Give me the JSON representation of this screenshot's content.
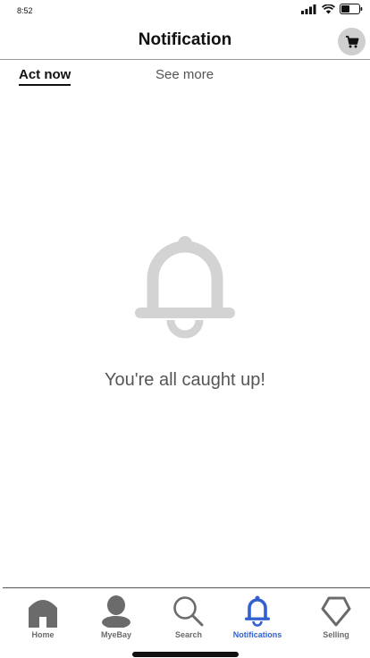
{
  "status": {
    "time": "8:52"
  },
  "header": {
    "title": "Notification",
    "cart_icon": "cart-icon"
  },
  "tabs": [
    {
      "label": "Act now",
      "active": true
    },
    {
      "label": "See more",
      "active": false
    }
  ],
  "empty_state": {
    "icon": "bell-icon",
    "message": "You're all caught up!"
  },
  "nav": {
    "items": [
      {
        "label": "Home",
        "icon": "home-icon",
        "active": false
      },
      {
        "label": "MyeBay",
        "icon": "person-icon",
        "active": false
      },
      {
        "label": "Search",
        "icon": "search-icon",
        "active": false
      },
      {
        "label": "Notifications",
        "icon": "bell-icon",
        "active": true
      },
      {
        "label": "Selling",
        "icon": "tag-icon",
        "active": false
      }
    ]
  },
  "colors": {
    "accent": "#3360d0",
    "muted_icon": "#6b6b6b",
    "empty_icon": "#d3d3d3"
  }
}
